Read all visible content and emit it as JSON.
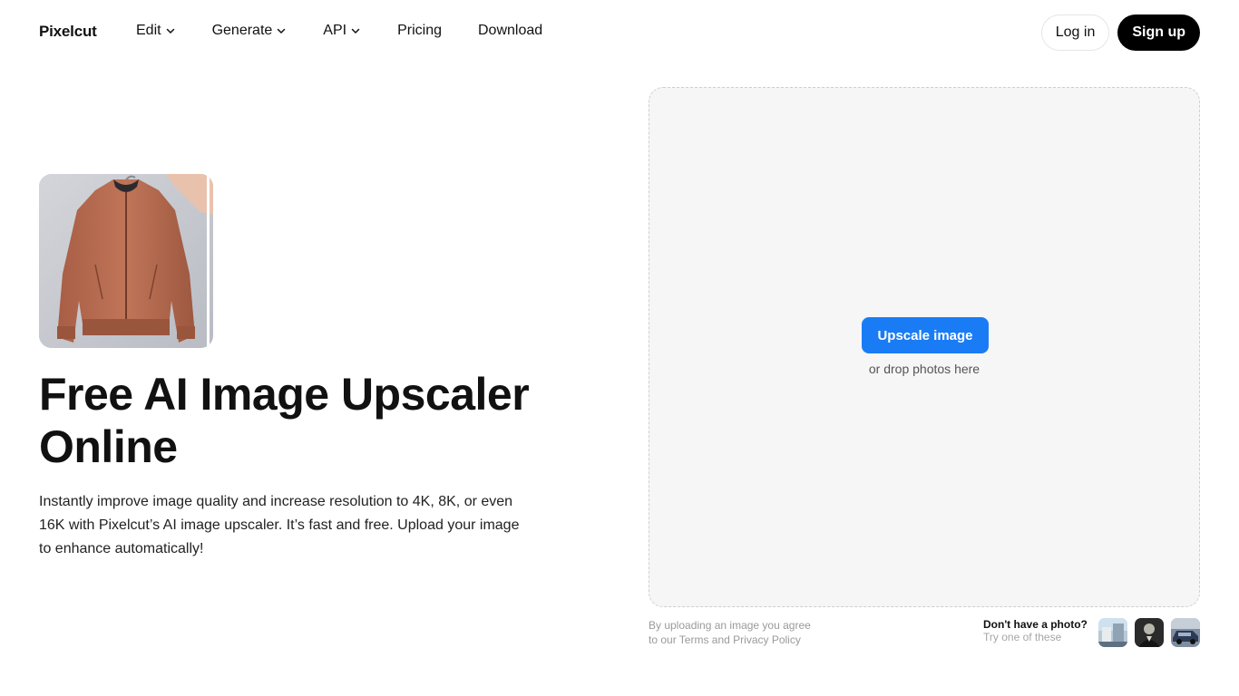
{
  "nav": {
    "logo": "Pixelcut",
    "items": [
      {
        "label": "Edit",
        "dropdown": true
      },
      {
        "label": "Generate",
        "dropdown": true
      },
      {
        "label": "API",
        "dropdown": true
      },
      {
        "label": "Pricing",
        "dropdown": false
      },
      {
        "label": "Download",
        "dropdown": false
      }
    ],
    "login": "Log in",
    "signup": "Sign up"
  },
  "hero": {
    "title": "Free AI Image Upscaler Online",
    "description": "Instantly improve image quality and increase resolution to 4K, 8K, or even 16K with Pixelcut’s AI image upscaler. It’s fast and free. Upload your image to enhance automatically!",
    "image_icon": "jacket-photo"
  },
  "upload": {
    "button": "Upscale image",
    "hint": "or drop photos here",
    "legal_line1": "By uploading an image you agree",
    "legal_line2": "to our Terms and Privacy Policy",
    "samples_question": "Don't have a photo?",
    "samples_hint": "Try one of these",
    "samples": [
      "building-sample",
      "portrait-sample",
      "car-sample"
    ]
  },
  "colors": {
    "accent": "#1a7cf5",
    "signup_bg": "#000000",
    "dropzone_bg": "#f6f6f6"
  }
}
